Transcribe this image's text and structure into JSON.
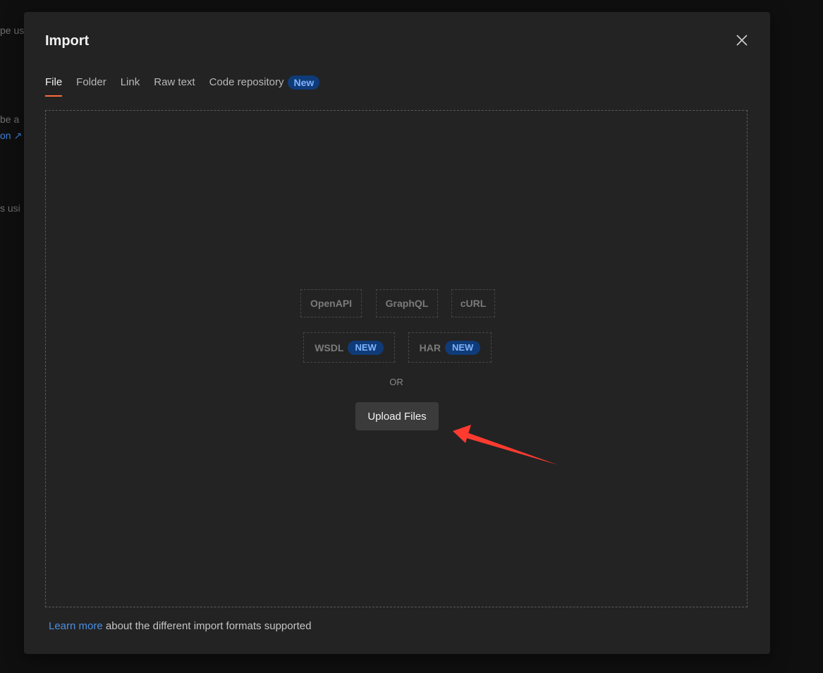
{
  "background": {
    "fragments": [
      "pe us",
      "be a",
      "on ↗",
      "s usi"
    ]
  },
  "modal": {
    "title": "Import",
    "close_icon": "close-icon",
    "tabs": [
      {
        "label": "File",
        "active": true
      },
      {
        "label": "Folder",
        "active": false
      },
      {
        "label": "Link",
        "active": false
      },
      {
        "label": "Raw text",
        "active": false
      },
      {
        "label": "Code repository",
        "badge": "New",
        "active": false
      }
    ],
    "formats": {
      "row1": [
        "OpenAPI",
        "GraphQL",
        "cURL"
      ],
      "row2": [
        {
          "label": "WSDL",
          "badge": "NEW"
        },
        {
          "label": "HAR",
          "badge": "NEW"
        }
      ]
    },
    "or_label": "OR",
    "upload_button": "Upload Files",
    "footer": {
      "link_text": "Learn more",
      "rest_text": " about the different import formats supported"
    }
  },
  "colors": {
    "accent": "#ff6c37",
    "badge_bg": "#0f3b78",
    "badge_text": "#7fb3ff",
    "link": "#4a90e2",
    "annotation_arrow": "#ff3b30"
  }
}
